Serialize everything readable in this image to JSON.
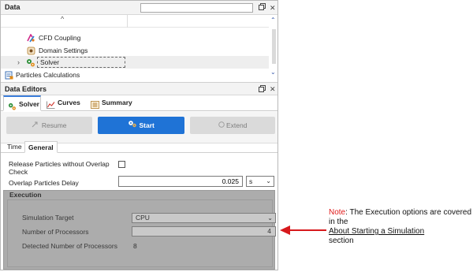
{
  "data_panel": {
    "title": "Data",
    "search_value": "",
    "tree": [
      {
        "label": "CFD Coupling",
        "icon": "cfd-coupling-icon"
      },
      {
        "label": "Domain Settings",
        "icon": "domain-settings-icon"
      },
      {
        "label": "Solver",
        "icon": "solver-icon",
        "selected": true,
        "expandable": true
      },
      {
        "label": "Particles Calculations",
        "icon": "particles-calculations-icon"
      }
    ]
  },
  "editors": {
    "title": "Data Editors",
    "tabs": [
      {
        "label": "Solver",
        "icon": "solver-icon",
        "active": true
      },
      {
        "label": "Curves",
        "icon": "curves-icon"
      },
      {
        "label": "Summary",
        "icon": "summary-icon"
      }
    ],
    "actions": {
      "resume": "Resume",
      "start": "Start",
      "extend": "Extend"
    },
    "subtabs": [
      {
        "label": "Time"
      },
      {
        "label": "General",
        "active": true
      }
    ],
    "properties": {
      "release_label": "Release Particles without Overlap Check",
      "release_checked": false,
      "delay_label": "Overlap Particles Delay",
      "delay_value": "0.025",
      "delay_unit": "s"
    },
    "execution": {
      "title": "Execution",
      "target_label": "Simulation Target",
      "target_value": "CPU",
      "processors_label": "Number of Processors",
      "processors_value": "4",
      "detected_label": "Detected Number of Processors",
      "detected_value": "8"
    }
  },
  "note": {
    "tag": "Note",
    "sep": ":",
    "text1": " The Execution options are covered in the",
    "link": "About Starting a Simulation",
    "text2": "section"
  },
  "colors": {
    "accent": "#1f73d6",
    "note_tag": "#e01b1b",
    "arrow": "#d7191c",
    "disabled_overlay": "#acacac"
  }
}
